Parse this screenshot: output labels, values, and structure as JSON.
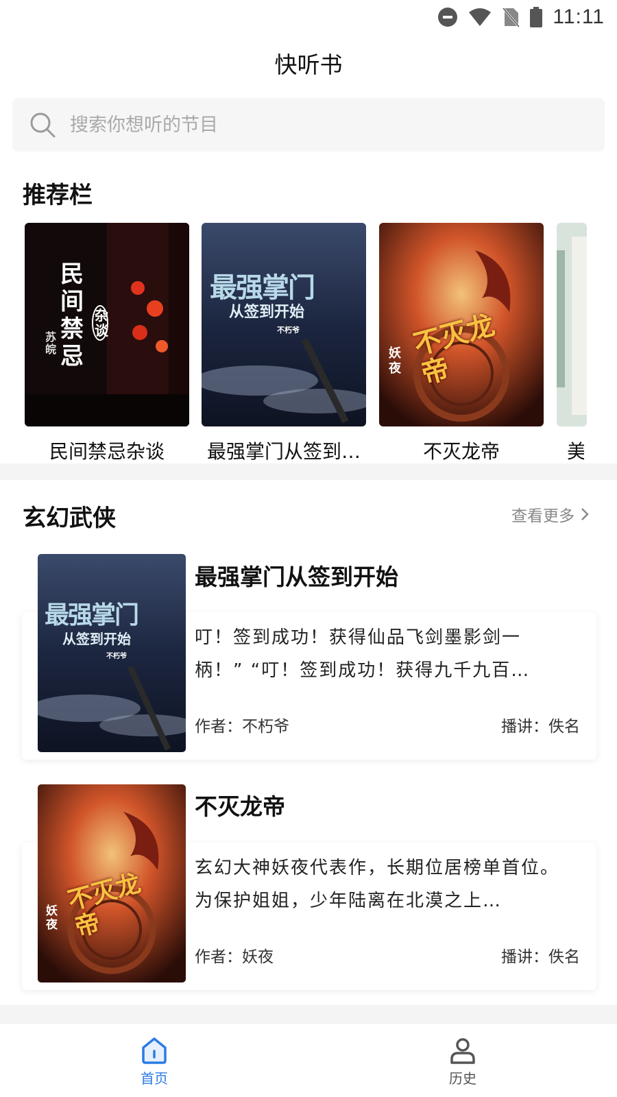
{
  "status_bar": {
    "time": "11:11"
  },
  "app": {
    "title": "快听书"
  },
  "search": {
    "placeholder": "搜索你想听的节目"
  },
  "recommended": {
    "title": "推荐栏",
    "items": [
      {
        "label": "民间禁忌杂谈",
        "cover_text": "民间禁忌",
        "cover_sub": "杂谈",
        "cover_author": "苏皖"
      },
      {
        "label": "最强掌门从签到…",
        "cover_text": "最强掌门",
        "cover_sub": "从签到开始",
        "cover_author": "不朽爷"
      },
      {
        "label": "不灭龙帝",
        "cover_text": "不灭龙帝",
        "cover_sub": "妖夜",
        "cover_author": ""
      },
      {
        "label": "美",
        "cover_text": "",
        "cover_sub": "",
        "cover_author": ""
      }
    ]
  },
  "category": {
    "title": "玄幻武侠",
    "more_label": "查看更多",
    "books": [
      {
        "title": "最强掌门从签到开始",
        "description": "叮！签到成功！获得仙品飞剑墨影剑一柄！” “叮！签到成功！获得九千九百…",
        "author": "作者：不朽爷",
        "narrator": "播讲：佚名",
        "cover_text": "最强掌门",
        "cover_sub": "从签到开始",
        "cover_author": "不朽爷"
      },
      {
        "title": "不灭龙帝",
        "description": "玄幻大神妖夜代表作，长期位居榜单首位。为保护姐姐，少年陆离在北漠之上…",
        "author": "作者：妖夜",
        "narrator": "播讲：佚名",
        "cover_text": "不灭龙帝",
        "cover_sub": "妖夜",
        "cover_author": ""
      }
    ]
  },
  "nav": {
    "home_label": "首页",
    "history_label": "历史"
  },
  "colors": {
    "accent": "#2b7be4",
    "divider": "#f4f4f4",
    "search_bg": "#f6f6f6"
  }
}
